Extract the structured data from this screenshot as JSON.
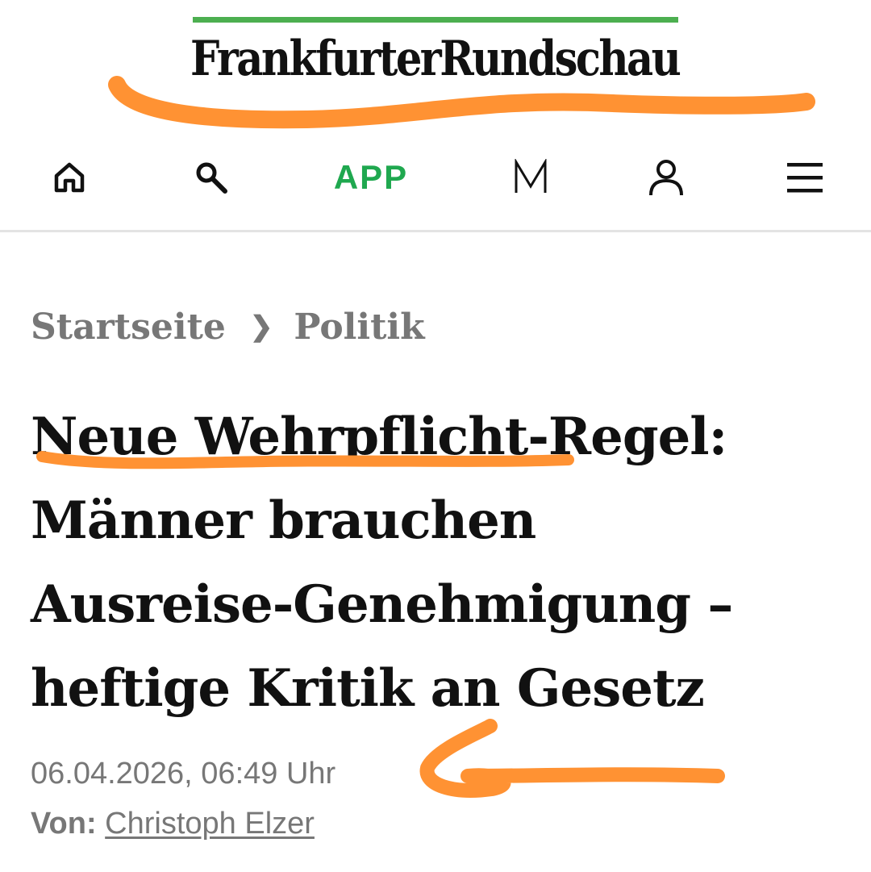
{
  "masthead": {
    "logo_text": "FrankfurterRundschau"
  },
  "nav": {
    "items": [
      {
        "label": "",
        "icon": "home-icon"
      },
      {
        "label": "",
        "icon": "search-icon"
      },
      {
        "label": "APP",
        "icon": ""
      },
      {
        "label": "",
        "icon": "m-logo-icon"
      },
      {
        "label": "",
        "icon": "user-icon"
      },
      {
        "label": "",
        "icon": "menu-icon"
      }
    ]
  },
  "breadcrumb": {
    "home": "Startseite",
    "separator": "❯",
    "section": "Politik"
  },
  "article": {
    "headline_lines": [
      "Neue Wehrpflicht-Regel:",
      "Männer brauchen",
      "Ausreise-Genehmigung –",
      "heftige Kritik an Gesetz"
    ],
    "date": "06.04.2026, 06:49 Uhr",
    "byline_label": "Von:",
    "author": "Christoph Elzer"
  },
  "colors": {
    "brand_green": "#4caf50",
    "app_green": "#1fa84f",
    "annotation_orange": "#ff9233",
    "meta_gray": "#777777"
  }
}
